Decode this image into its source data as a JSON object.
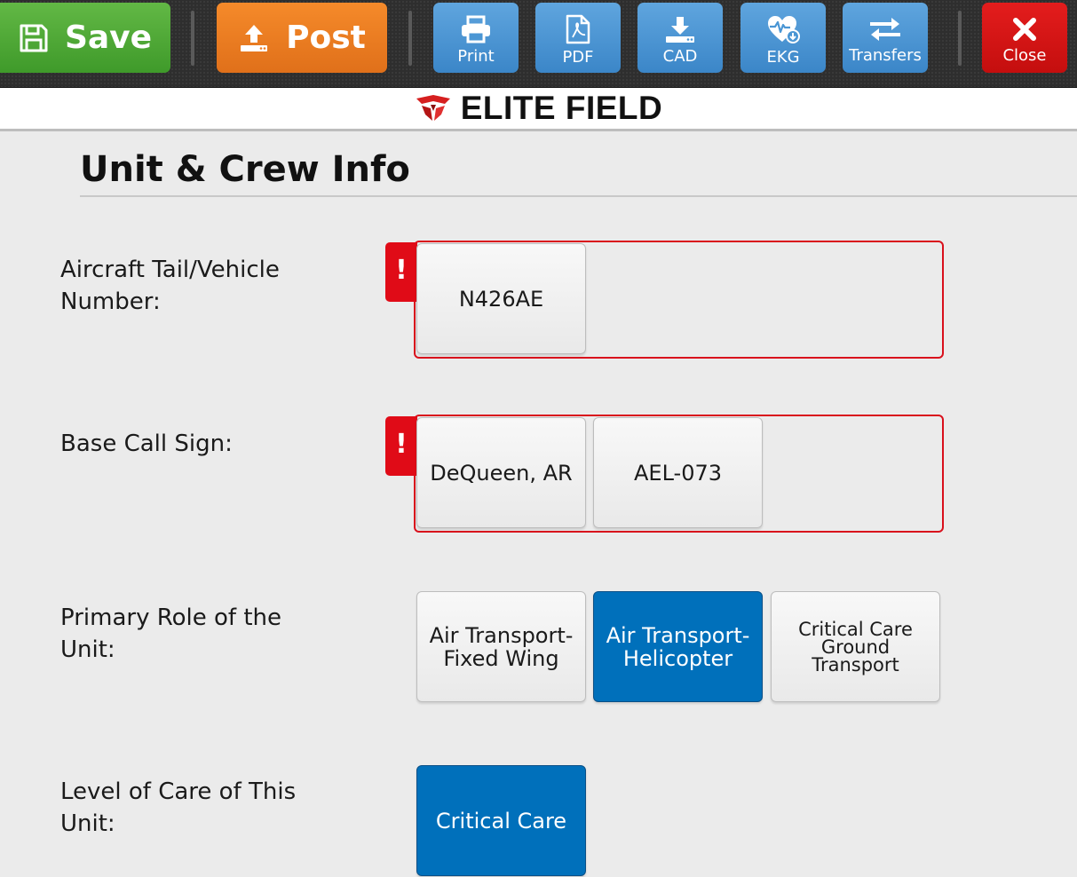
{
  "toolbar": {
    "save_label": "Save",
    "post_label": "Post",
    "print_label": "Print",
    "pdf_label": "PDF",
    "cad_label": "CAD",
    "ekg_label": "EKG",
    "transfers_label": "Transfers",
    "close_label": "Close"
  },
  "brand": {
    "name": "ELITE FIELD"
  },
  "section": {
    "title": "Unit & Crew Info"
  },
  "fields": {
    "tail_number": {
      "label": "Aircraft Tail/Vehicle Number:",
      "required_marker": "!",
      "options": [
        "N426AE"
      ]
    },
    "call_sign": {
      "label": "Base Call Sign:",
      "required_marker": "!",
      "options": [
        "DeQueen, AR",
        "AEL-073"
      ]
    },
    "primary_role": {
      "label": "Primary Role of the Unit:",
      "options": [
        "Air Transport-Fixed Wing",
        "Air Transport-Helicopter",
        "Critical Care Ground Transport"
      ],
      "selected": "Air Transport-Helicopter"
    },
    "level_of_care": {
      "label": "Level of Care of This Unit:",
      "options": [
        "Critical Care"
      ],
      "selected": "Critical Care"
    }
  },
  "colors": {
    "save": "#4aa834",
    "post": "#ee7d22",
    "action": "#4a96d4",
    "close": "#d41414",
    "required": "#e00b17",
    "selected": "#0070bb",
    "brand_logo": "#d61f1f"
  }
}
